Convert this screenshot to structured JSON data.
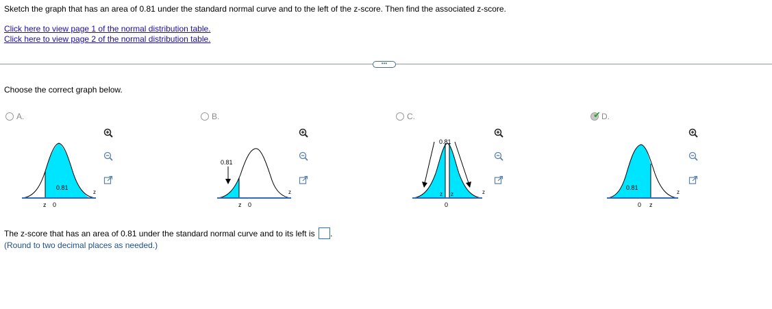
{
  "question": "Sketch the graph that has an area of 0.81 under the standard normal curve and to the left of the z-score. Then find the associated z-score.",
  "links": [
    "Click here to view page 1 of the normal distribution table.",
    "Click here to view page 2 of the normal distribution table."
  ],
  "more_button": "•••",
  "prompt": "Choose the correct graph below.",
  "options": [
    {
      "letter": "A.",
      "area_label": "0.81",
      "axis_labels": [
        "z",
        "0"
      ],
      "z_axis": "z",
      "selected": false
    },
    {
      "letter": "B.",
      "area_label": "0.81",
      "axis_labels": [
        "z",
        "0"
      ],
      "z_axis": "z",
      "selected": false
    },
    {
      "letter": "C.",
      "area_label": "0.81",
      "axis_labels": [
        "z",
        "z",
        "0"
      ],
      "z_axis": "z",
      "selected": false
    },
    {
      "letter": "D.",
      "area_label": "0.81",
      "axis_labels": [
        "0",
        "z"
      ],
      "z_axis": "z",
      "selected": true
    }
  ],
  "answer_text": "The z-score that has an area of 0.81 under the standard normal curve and to its left is",
  "answer_suffix": ".",
  "answer_value": "",
  "hint": "(Round to two decimal places as needed.)",
  "colors": {
    "fill": "#00e5ff",
    "link": "#1a0dab",
    "check": "#2e9e2e",
    "hint": "#1e4f86"
  },
  "icons": [
    "zoom-in-icon",
    "zoom-out-icon",
    "popout-icon",
    "checkmark-icon"
  ]
}
